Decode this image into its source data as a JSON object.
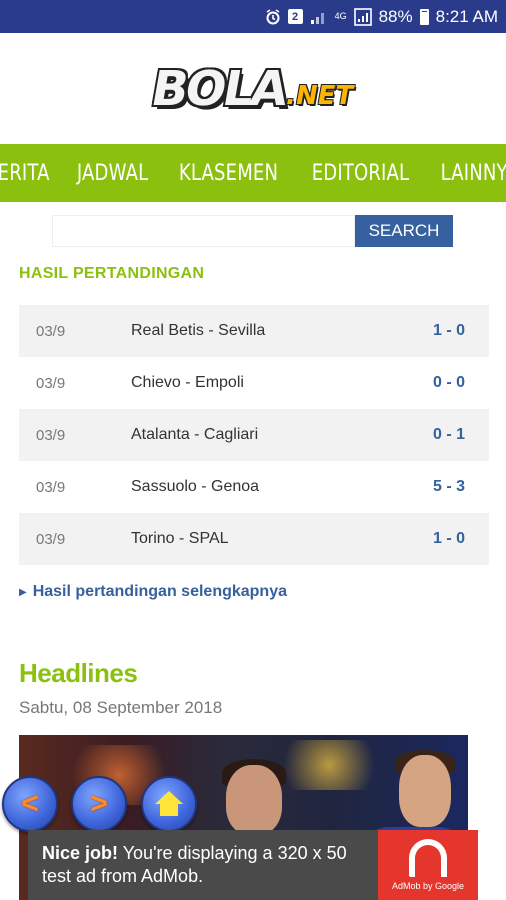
{
  "status_bar": {
    "battery": "88%",
    "time": "8:21 AM",
    "notification_badge": "2",
    "network": "4G"
  },
  "logo": {
    "main": "BOLA",
    "suffix": ".NET"
  },
  "nav": {
    "color": "#8cc00f",
    "items": [
      "BERITA",
      "JADWAL",
      "KLASEMEN",
      "EDITORIAL",
      "LAINNYA"
    ]
  },
  "search": {
    "placeholder": "",
    "value": "",
    "button_label": "SEARCH"
  },
  "results": {
    "title": "HASIL PERTANDINGAN",
    "rows": [
      {
        "date": "03/9",
        "teams": "Real Betis - Sevilla",
        "score": "1 - 0"
      },
      {
        "date": "03/9",
        "teams": "Chievo - Empoli",
        "score": "0 - 0"
      },
      {
        "date": "03/9",
        "teams": "Atalanta - Cagliari",
        "score": "0 - 1"
      },
      {
        "date": "03/9",
        "teams": "Sassuolo - Genoa",
        "score": "5 - 3"
      },
      {
        "date": "03/9",
        "teams": "Torino - SPAL",
        "score": "1 - 0"
      }
    ],
    "more_link": "Hasil pertandingan selengkapnya"
  },
  "headlines": {
    "title": "Headlines",
    "date": "Sabtu, 08 September 2018"
  },
  "floating_buttons": {
    "back": "<",
    "forward": ">",
    "home": "home-icon"
  },
  "ad": {
    "bold": "Nice job!",
    "text": " You're displaying a 320 x 50 test ad from AdMob.",
    "logo_caption": "AdMob by Google"
  }
}
